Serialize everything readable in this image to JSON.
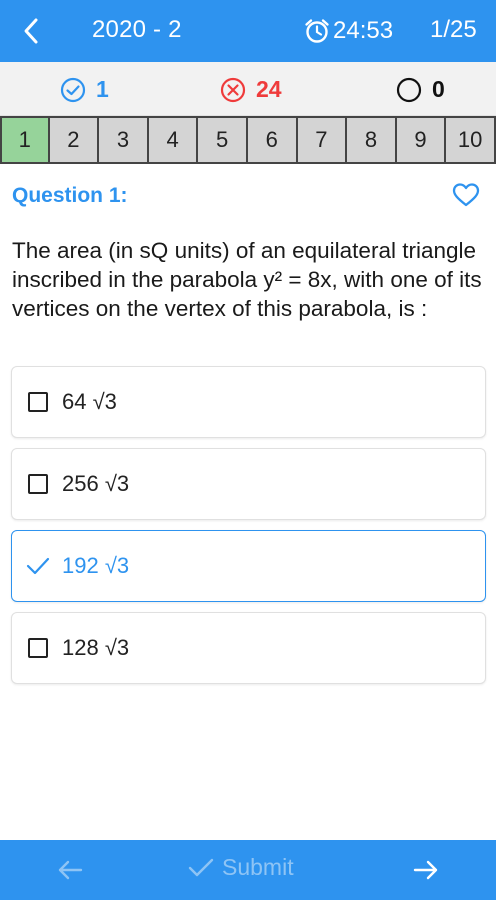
{
  "header": {
    "title": "2020 - 2",
    "timer": "24:53",
    "progress": "1/25"
  },
  "stats": {
    "correct": "1",
    "wrong": "24",
    "skipped": "0"
  },
  "question_nav": [
    "1",
    "2",
    "3",
    "4",
    "5",
    "6",
    "7",
    "8",
    "9",
    "10"
  ],
  "question": {
    "label": "Question 1:",
    "text": "The area (in sQ units) of an equilateral triangle inscribed in the parabola y² = 8x, with one of its vertices on the vertex of this parabola, is :",
    "options": [
      {
        "text": "64 √3",
        "selected": false
      },
      {
        "text": "256 √3",
        "selected": false
      },
      {
        "text": "192 √3",
        "selected": true
      },
      {
        "text": "128 √3",
        "selected": false
      }
    ]
  },
  "footer": {
    "submit_label": "Submit"
  },
  "colors": {
    "primary": "#2e93ef",
    "wrong": "#ef3b3b",
    "current_question": "#96d39a"
  }
}
